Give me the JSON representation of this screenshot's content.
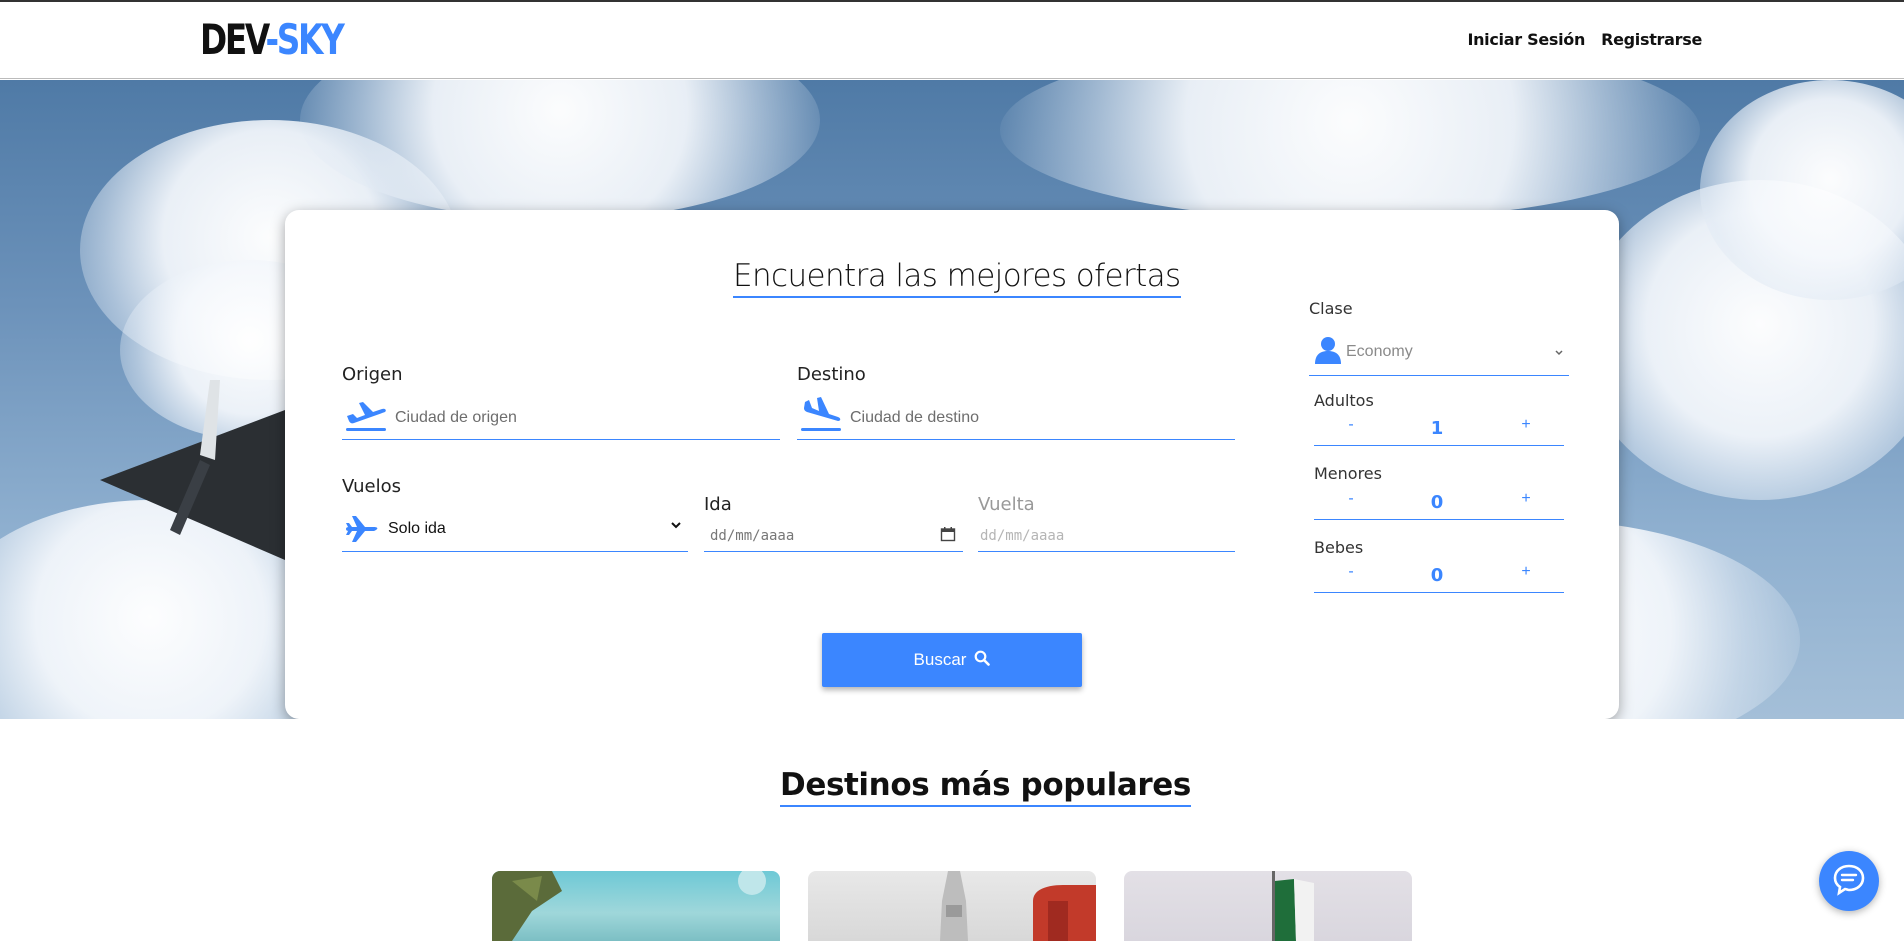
{
  "brand": {
    "part1": "DEV",
    "separator": "-",
    "part2": "SKY"
  },
  "nav": {
    "login": "Iniciar Sesión",
    "register": "Registrarse"
  },
  "search": {
    "title": "Encuentra las mejores ofertas",
    "origin": {
      "label": "Origen",
      "placeholder": "Ciudad de origen",
      "icon": "plane-departure-icon"
    },
    "destination": {
      "label": "Destino",
      "placeholder": "Ciudad de destino",
      "icon": "plane-arrival-icon"
    },
    "flights": {
      "label": "Vuelos",
      "selected": "Solo ida",
      "icon": "plane-icon"
    },
    "departure": {
      "label": "Ida",
      "placeholder": "dd/mm/aaaa"
    },
    "return": {
      "label": "Vuelta",
      "placeholder": "dd/mm/aaaa"
    },
    "class": {
      "label": "Clase",
      "selected": "Economy",
      "icon": "user-icon"
    },
    "adults": {
      "label": "Adultos",
      "value": "1",
      "minus": "-",
      "plus": "+"
    },
    "minors": {
      "label": "Menores",
      "value": "0",
      "minus": "-",
      "plus": "+"
    },
    "babies": {
      "label": "Bebes",
      "value": "0",
      "minus": "-",
      "plus": "+"
    },
    "button": {
      "label": "Buscar",
      "icon": "search-icon"
    }
  },
  "popular": {
    "title": "Destinos más populares"
  },
  "colors": {
    "accent": "#3b86ff",
    "text": "#111111"
  }
}
